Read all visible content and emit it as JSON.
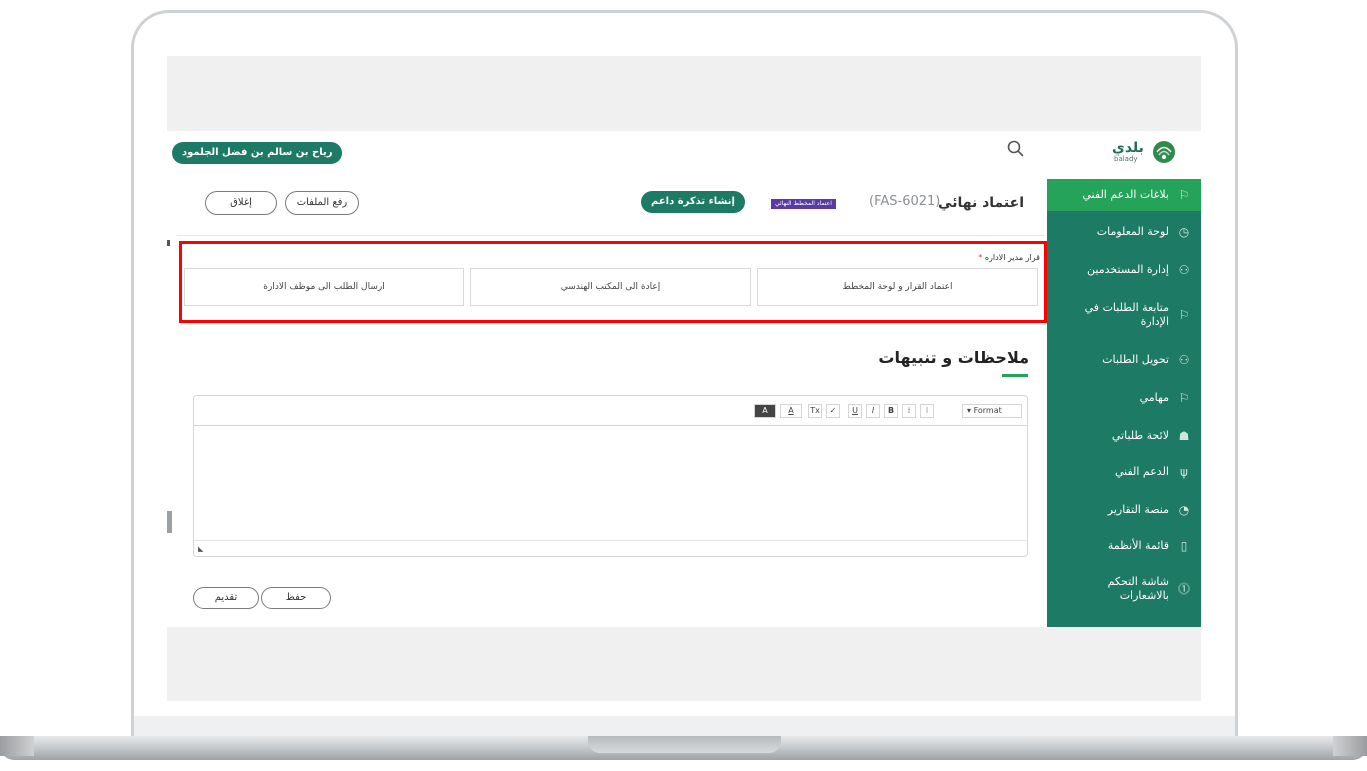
{
  "topbar": {
    "user_name": "رياح بن سالم بن فضل الجلمود",
    "logo_ar": "بلدي",
    "logo_en": "balady"
  },
  "sidebar": {
    "items": [
      {
        "label": "بلاغات الدعم الفني",
        "icon": "flag-icon",
        "active": true
      },
      {
        "label": "لوحة المعلومات",
        "icon": "dashboard-icon",
        "active": false
      },
      {
        "label": "إدارة المستخدمين",
        "icon": "users-icon",
        "active": false
      },
      {
        "label": "متابعة الطلبات في الإدارة",
        "icon": "flag-icon",
        "active": false
      },
      {
        "label": "تحويل الطلبات",
        "icon": "users-icon",
        "active": false
      },
      {
        "label": "مهامي",
        "icon": "flag-icon",
        "active": false
      },
      {
        "label": "لائحة طلباتي",
        "icon": "user-list-icon",
        "active": false
      },
      {
        "label": "الدعم الفني",
        "icon": "antenna-icon",
        "active": false
      },
      {
        "label": "منصة التقارير",
        "icon": "chart-icon",
        "active": false
      },
      {
        "label": "قائمة الأنظمة",
        "icon": "document-icon",
        "active": false
      },
      {
        "label": "شاشة التحكم بالاشعارات",
        "icon": "bell-icon",
        "active": false
      }
    ]
  },
  "header": {
    "title": "اعتماد نهائي",
    "code": "(FAS-6021)",
    "badge": "اعتماد المخطط النهائي",
    "ticket_button": "إنشاء تذكرة داعم",
    "upload_button": "رفع الملفات",
    "close_button": "إغلاق"
  },
  "decision": {
    "label": "قرار مدير الاداره",
    "required_mark": "*",
    "options": [
      "اعتماد القرار و لوحة المخطط",
      "إعادة الى المكتب الهندسي",
      "ارسال الطلب الى موظف الادارة"
    ]
  },
  "notes": {
    "title": "ملاحظات و تنبيهات",
    "format_label": "Format",
    "toolbar": [
      "B",
      "I",
      "U",
      "Tx",
      "A",
      "A"
    ],
    "grip": "◣"
  },
  "actions": {
    "save": "حفظ",
    "submit": "تقديم"
  },
  "colors": {
    "brand_green": "#1d7a64",
    "active_green": "#25a35a",
    "highlight_red": "#ff0000",
    "badge_purple": "#5b3aa8"
  }
}
